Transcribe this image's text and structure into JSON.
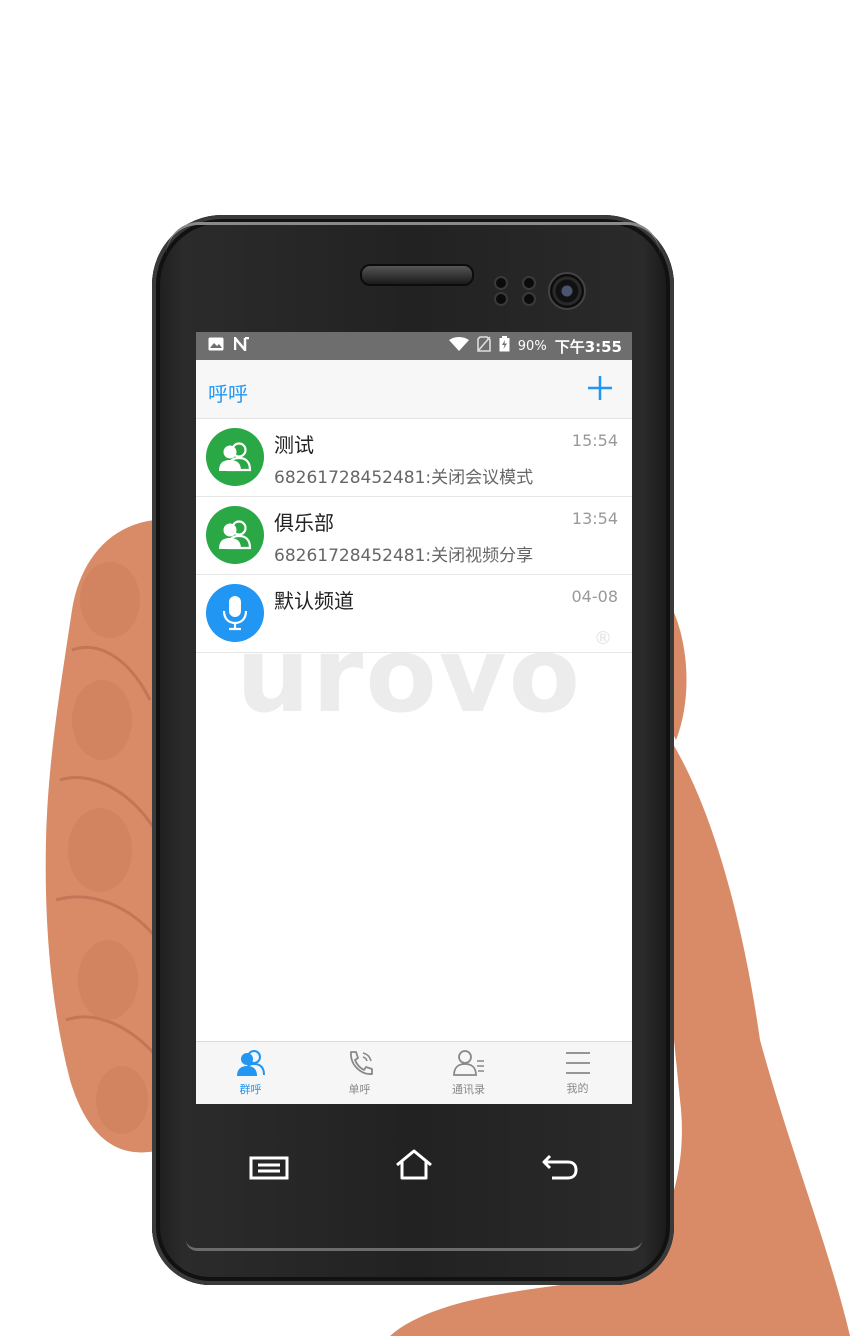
{
  "status_bar": {
    "battery_percent": "90%",
    "time": "下午3:55"
  },
  "app_bar": {
    "title": "呼呼"
  },
  "watermark": "urovo",
  "watermark_mark": "®",
  "groups": [
    {
      "name": "测试",
      "last_message": "68261728452481:关闭会议模式",
      "time": "15:54",
      "avatar_type": "group",
      "avatar_color": "#2aa845"
    },
    {
      "name": "俱乐部",
      "last_message": "68261728452481:关闭视频分享",
      "time": "13:54",
      "avatar_type": "group",
      "avatar_color": "#2aa845"
    },
    {
      "name": "默认频道",
      "last_message": "",
      "time": "04-08",
      "avatar_type": "microphone",
      "avatar_color": "#2196f3"
    }
  ],
  "tabs": [
    {
      "label": "群呼",
      "icon": "group-call-icon",
      "active": true
    },
    {
      "label": "单呼",
      "icon": "phone-call-icon",
      "active": false
    },
    {
      "label": "通讯录",
      "icon": "contacts-icon",
      "active": false
    },
    {
      "label": "我的",
      "icon": "menu-icon",
      "active": false
    }
  ],
  "colors": {
    "accent": "#2196f3",
    "group_avatar": "#2aa845",
    "skin": "#d98b68"
  }
}
